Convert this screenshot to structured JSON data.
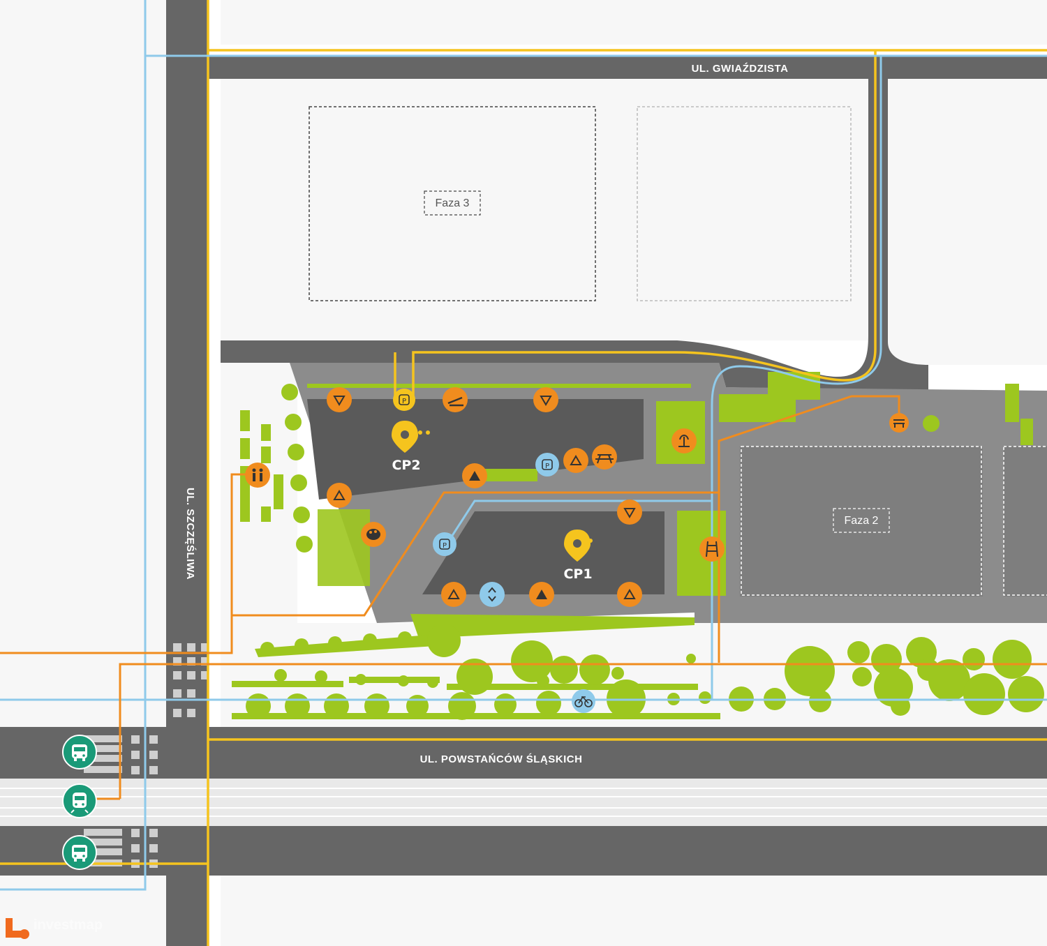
{
  "streets": {
    "north": "UL. GWIAŹDZISTA",
    "west": "UL. SZCZĘŚLIWA",
    "south": "UL. POWSTAŃCÓW ŚLĄSKICH"
  },
  "phases": {
    "phase3": "Faza 3",
    "phase2": "Faza 2"
  },
  "buildings": {
    "cp1": "CP1",
    "cp2": "CP2"
  },
  "watermark": {
    "text": "investmap"
  },
  "colors": {
    "road": "#666666",
    "building": "#5a5a5a",
    "plaza": "#8c8c8c",
    "green": "#9dc71f",
    "orange_route": "#f08c1e",
    "yellow_route": "#f5c41e",
    "blue_route": "#8fcaea",
    "transit": "#1a9a78",
    "poi_orange": "#f08c1e",
    "poi_blue": "#8fcaea",
    "cp_marker": "#f5c41e"
  },
  "legend_icons": {
    "transit_stops": [
      "bus-icon",
      "tram-icon",
      "bus-icon"
    ],
    "pois": [
      "entrance-icon",
      "parking-icon",
      "slide-icon",
      "exit-icon",
      "toilet-icon",
      "art-icon",
      "picnic-icon",
      "fountain-icon",
      "ladder-icon",
      "bench-icon",
      "bicycle-icon",
      "lift-icon"
    ]
  }
}
